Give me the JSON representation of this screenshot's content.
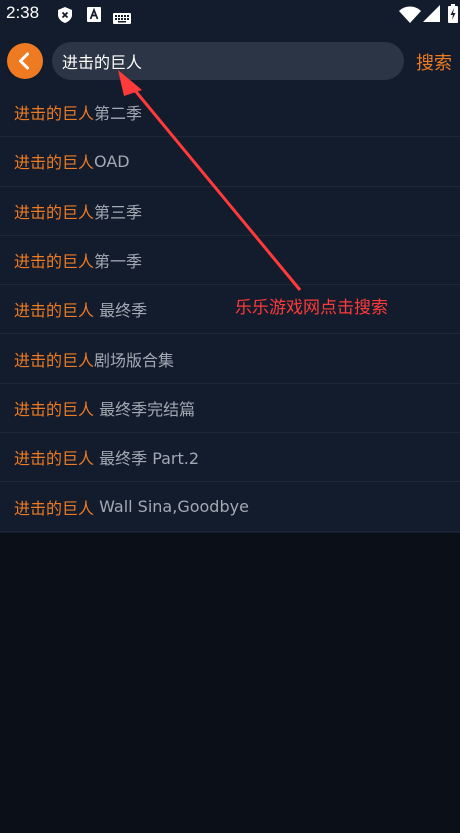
{
  "status_bar": {
    "time": "2:38",
    "icons": [
      "shield-x-icon",
      "font-a-icon",
      "keyboard-icon",
      "wifi-icon",
      "cell-signal-icon",
      "battery-charging-icon"
    ]
  },
  "search": {
    "back_icon": "chevron-left-icon",
    "query": "进击的巨人",
    "submit_label": "搜索"
  },
  "suggestions": [
    {
      "keyword": "进击的巨人",
      "rest": "第二季"
    },
    {
      "keyword": "进击的巨人",
      "rest": "OAD"
    },
    {
      "keyword": "进击的巨人",
      "rest": "第三季"
    },
    {
      "keyword": "进击的巨人",
      "rest": "第一季"
    },
    {
      "keyword": "进击的巨人",
      "rest": " 最终季"
    },
    {
      "keyword": "进击的巨人",
      "rest": "剧场版合集"
    },
    {
      "keyword": "进击的巨人",
      "rest": " 最终季完结篇"
    },
    {
      "keyword": "进击的巨人",
      "rest": " 最终季 Part.2"
    },
    {
      "keyword": "进击的巨人",
      "rest": " Wall Sina,Goodbye"
    }
  ],
  "annotation": {
    "text": "乐乐游戏网点击搜索",
    "color": "#ff3a3a"
  },
  "colors": {
    "accent": "#ee7a22",
    "panel": "#131c2c",
    "background": "#0a0f18"
  }
}
